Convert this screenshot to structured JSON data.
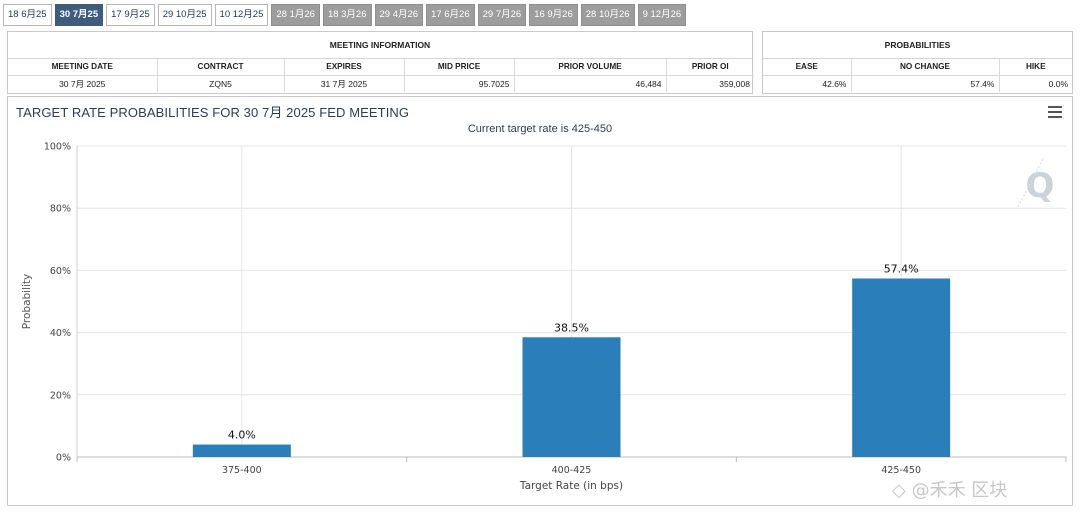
{
  "tabs": [
    {
      "label": "18 6月25",
      "state": "past"
    },
    {
      "label": "30 7月25",
      "state": "active"
    },
    {
      "label": "17 9月25",
      "state": "past"
    },
    {
      "label": "29 10月25",
      "state": "past"
    },
    {
      "label": "10 12月25",
      "state": "past"
    },
    {
      "label": "28 1月26",
      "state": "future"
    },
    {
      "label": "18 3月26",
      "state": "future"
    },
    {
      "label": "29 4月26",
      "state": "future"
    },
    {
      "label": "17 6月26",
      "state": "future"
    },
    {
      "label": "29 7月26",
      "state": "future"
    },
    {
      "label": "16 9月26",
      "state": "future"
    },
    {
      "label": "28 10月26",
      "state": "future"
    },
    {
      "label": "9 12月26",
      "state": "future"
    }
  ],
  "meeting_info": {
    "title": "MEETING INFORMATION",
    "headers": [
      "MEETING DATE",
      "CONTRACT",
      "EXPIRES",
      "MID PRICE",
      "PRIOR VOLUME",
      "PRIOR OI"
    ],
    "values": [
      "30 7月 2025",
      "ZQN5",
      "31 7月 2025",
      "95.7025",
      "46,484",
      "359,008"
    ]
  },
  "probabilities": {
    "title": "PROBABILITIES",
    "headers": [
      "EASE",
      "NO CHANGE",
      "HIKE"
    ],
    "values": [
      "42.6%",
      "57.4%",
      "0.0%"
    ]
  },
  "chart": {
    "title": "TARGET RATE PROBABILITIES FOR 30 7月 2025 FED MEETING",
    "subtitle": "Current target rate is 425-450",
    "logo": "Q"
  },
  "chart_data": {
    "type": "bar",
    "title": "TARGET RATE PROBABILITIES FOR 30 7月 2025 FED MEETING",
    "subtitle": "Current target rate is 425-450",
    "categories": [
      "375-400",
      "400-425",
      "425-450"
    ],
    "values": [
      4.0,
      38.5,
      57.4
    ],
    "value_labels": [
      "4.0%",
      "38.5%",
      "57.4%"
    ],
    "xlabel": "Target Rate (in bps)",
    "ylabel": "Probability",
    "ylim": [
      0,
      100
    ],
    "yticks": [
      0,
      20,
      40,
      60,
      80,
      100
    ],
    "ytick_labels": [
      "0%",
      "20%",
      "40%",
      "60%",
      "80%",
      "100%"
    ],
    "grid": true,
    "bar_color": "#2a7fba"
  },
  "watermark": "◇ @禾禾   区块"
}
